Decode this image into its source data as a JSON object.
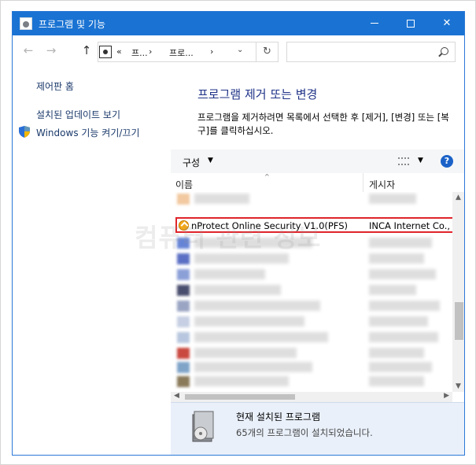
{
  "window": {
    "title": "프로그램 및 기능",
    "minimize_label": "",
    "maximize_label": "",
    "close_label": "✕"
  },
  "navigation": {
    "back_icon": "back-arrow-icon",
    "forward_icon": "forward-arrow-icon",
    "up_icon": "up-arrow-icon",
    "breadcrumb": [
      "«",
      "프...",
      "프로..."
    ],
    "search_placeholder": ""
  },
  "sidebar": {
    "items": [
      {
        "label": "제어판 홈"
      },
      {
        "label": "설치된 업데이트 보기"
      },
      {
        "label": "Windows 기능 켜기/끄기"
      }
    ]
  },
  "main": {
    "title": "프로그램 제거 또는 변경",
    "description": "프로그램을 제거하려면 목록에서 선택한 후 [제거], [변경] 또는 [복구]를 클릭하십시오."
  },
  "toolbar": {
    "organize_label": "구성",
    "help_label": "?"
  },
  "list": {
    "columns": [
      "이름",
      "게시자"
    ],
    "selected_item": {
      "name": "nProtect Online Security V1.0(PFS)",
      "publisher": "INCA Internet Co., L"
    },
    "item_count_visible": 17
  },
  "details": {
    "title": "현재 설치된 프로그램",
    "count_text": "65개의 프로그램이 설치되었습니다."
  },
  "watermark": "컴퓨터 관련 정보",
  "colors": {
    "titlebar": "#1a73d3",
    "highlight_border": "#e0252b",
    "link": "#1b3a6b",
    "heading": "#1e3287",
    "details_bg": "#e9f0fa"
  }
}
